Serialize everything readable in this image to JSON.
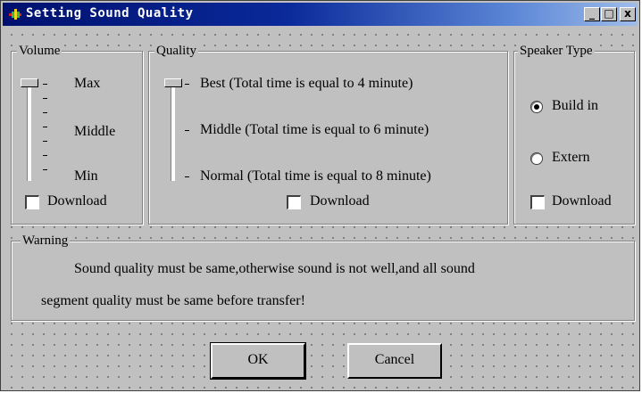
{
  "window": {
    "title": "Setting Sound Quality",
    "controls": {
      "minimize": "_",
      "maximize": "□",
      "close": "x"
    }
  },
  "volume": {
    "label": "Volume",
    "levels": [
      "Max",
      "Middle",
      "Min"
    ],
    "selected": "Max",
    "download_label": "Download",
    "download_checked": false
  },
  "quality": {
    "label": "Quality",
    "levels": [
      "Best (Total time is equal to 4 minute)",
      "Middle (Total time is equal to 6 minute)",
      "Normal (Total time is equal to 8 minute)"
    ],
    "selected": "Best (Total time is equal to 4 minute)",
    "download_label": "Download",
    "download_checked": false
  },
  "speaker": {
    "label": "Speaker Type",
    "options": [
      "Build in",
      "Extern"
    ],
    "selected": "Build in",
    "download_label": "Download",
    "download_checked": false
  },
  "warning": {
    "label": "Warning",
    "line1": "Sound quality must be  same,otherwise  sound  is not well,and all sound",
    "line2": "segment quality must be same before transfer!"
  },
  "buttons": {
    "ok": "OK",
    "cancel": "Cancel"
  },
  "colors": {
    "title_start": "#00106e",
    "title_end": "#9fbcea",
    "face": "#c0c0c0"
  }
}
